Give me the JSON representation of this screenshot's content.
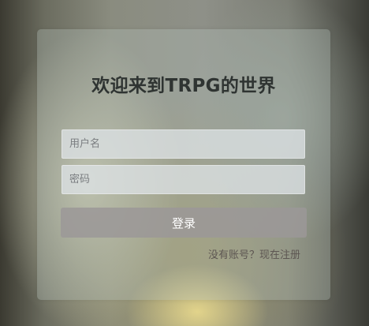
{
  "login": {
    "title": "欢迎来到TRPG的世界",
    "username_placeholder": "用户名",
    "password_placeholder": "密码",
    "submit_label": "登录",
    "register_link": "没有账号？现在注册"
  }
}
